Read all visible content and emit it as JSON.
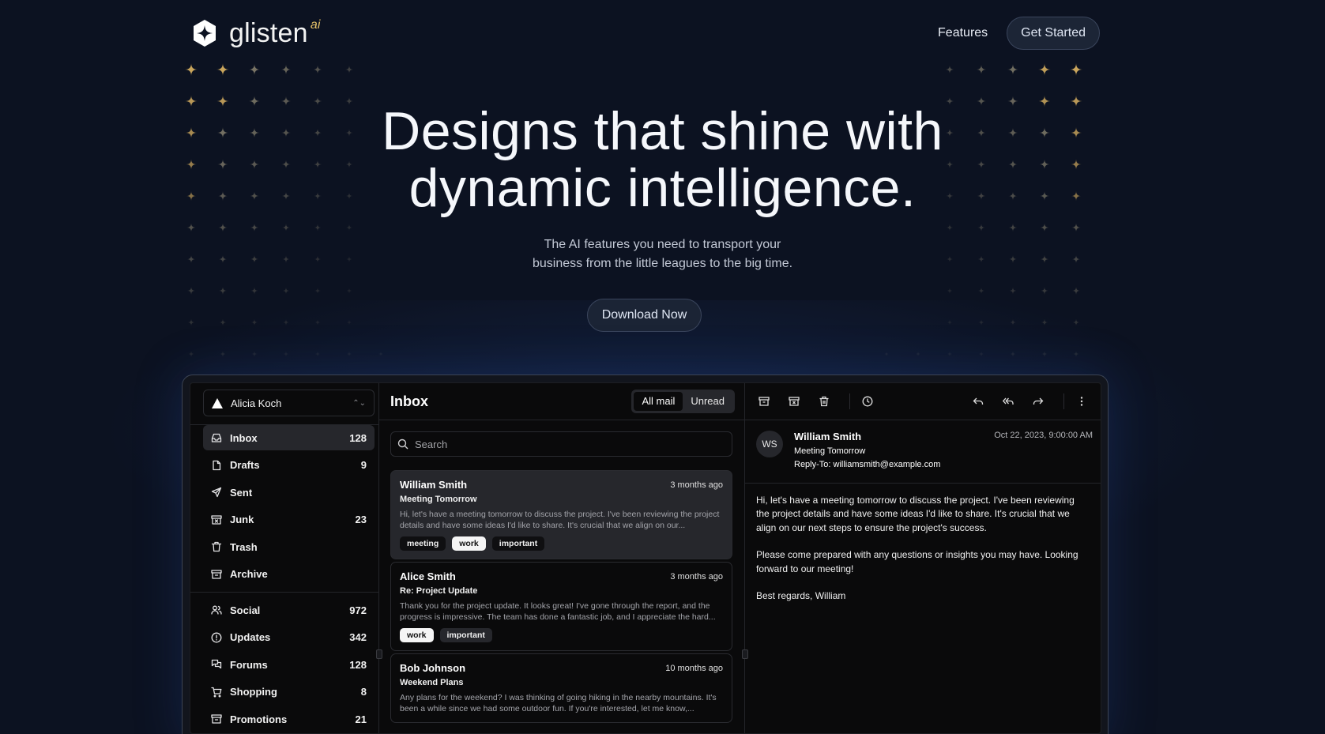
{
  "header": {
    "brand": "glisten",
    "brand_suffix": "ai",
    "nav_features": "Features",
    "get_started": "Get Started"
  },
  "hero": {
    "title_line1": "Designs that shine with",
    "title_line2": "dynamic intelligence.",
    "subtitle_line1": "The AI features you need to transport your",
    "subtitle_line2": "business from the little leagues to the big time.",
    "download": "Download Now"
  },
  "colors": {
    "background": "#0c1221",
    "accent_gold": "#e9c46a",
    "panel": "#0a0a0b"
  },
  "mail": {
    "account": "Alicia Koch",
    "nav": [
      {
        "label": "Inbox",
        "count": "128",
        "icon": "inbox-icon",
        "active": true
      },
      {
        "label": "Drafts",
        "count": "9",
        "icon": "file-icon"
      },
      {
        "label": "Sent",
        "count": "",
        "icon": "send-icon"
      },
      {
        "label": "Junk",
        "count": "23",
        "icon": "archive-x-icon"
      },
      {
        "label": "Trash",
        "count": "",
        "icon": "trash-icon"
      },
      {
        "label": "Archive",
        "count": "",
        "icon": "archive-icon"
      }
    ],
    "categories": [
      {
        "label": "Social",
        "count": "972",
        "icon": "users-icon"
      },
      {
        "label": "Updates",
        "count": "342",
        "icon": "alert-circle-icon"
      },
      {
        "label": "Forums",
        "count": "128",
        "icon": "messages-icon"
      },
      {
        "label": "Shopping",
        "count": "8",
        "icon": "cart-icon"
      },
      {
        "label": "Promotions",
        "count": "21",
        "icon": "archive-icon"
      }
    ],
    "list_title": "Inbox",
    "filter_all": "All mail",
    "filter_unread": "Unread",
    "search_placeholder": "Search",
    "messages": [
      {
        "name": "William Smith",
        "date": "3 months ago",
        "subject": "Meeting Tomorrow",
        "preview": "Hi, let's have a meeting tomorrow to discuss the project. I've been reviewing the project details and have some ideas I'd like to share. It's crucial that we align on our...",
        "tags": [
          "meeting",
          "work",
          "important"
        ]
      },
      {
        "name": "Alice Smith",
        "date": "3 months ago",
        "subject": "Re: Project Update",
        "preview": "Thank you for the project update. It looks great! I've gone through the report, and the progress is impressive. The team has done a fantastic job, and I appreciate the hard...",
        "tags": [
          "work",
          "important"
        ]
      },
      {
        "name": "Bob Johnson",
        "date": "10 months ago",
        "subject": "Weekend Plans",
        "preview": "Any plans for the weekend? I was thinking of going hiking in the nearby mountains. It's been a while since we had some outdoor fun. If you're interested, let me know,...",
        "tags": []
      }
    ],
    "detail": {
      "initials": "WS",
      "name": "William Smith",
      "subject": "Meeting Tomorrow",
      "reply_to": "Reply-To: williamsmith@example.com",
      "date": "Oct 22, 2023, 9:00:00 AM",
      "body": [
        "Hi, let's have a meeting tomorrow to discuss the project. I've been reviewing the project details and have some ideas I'd like to share. It's crucial that we align on our next steps to ensure the project's success.",
        "Please come prepared with any questions or insights you may have. Looking forward to our meeting!",
        "Best regards, William"
      ]
    }
  }
}
